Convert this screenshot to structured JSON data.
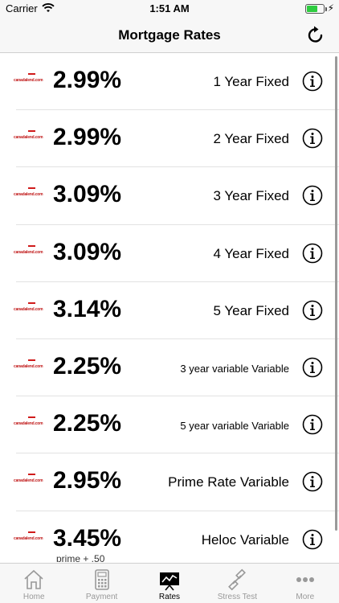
{
  "status_bar": {
    "carrier": "Carrier",
    "time": "1:51 AM"
  },
  "header": {
    "title": "Mortgage Rates"
  },
  "lender_logo_text": "canadalend.com",
  "rates": [
    {
      "rate": "2.99%",
      "term": "1 Year Fixed",
      "note": "",
      "small": false
    },
    {
      "rate": "2.99%",
      "term": "2 Year Fixed",
      "note": "",
      "small": false
    },
    {
      "rate": "3.09%",
      "term": "3 Year Fixed",
      "note": "",
      "small": false
    },
    {
      "rate": "3.09%",
      "term": "4 Year Fixed",
      "note": "",
      "small": false
    },
    {
      "rate": "3.14%",
      "term": "5 Year Fixed",
      "note": "",
      "small": false
    },
    {
      "rate": "2.25%",
      "term": "3 year variable Variable",
      "note": "",
      "small": true
    },
    {
      "rate": "2.25%",
      "term": "5 year variable Variable",
      "note": "",
      "small": true
    },
    {
      "rate": "2.95%",
      "term": "Prime Rate Variable",
      "note": "",
      "small": false
    },
    {
      "rate": "3.45%",
      "term": "Heloc Variable",
      "note": "prime + .50",
      "small": false
    }
  ],
  "tabs": [
    {
      "label": "Home",
      "icon": "home-icon"
    },
    {
      "label": "Payment",
      "icon": "calculator-icon"
    },
    {
      "label": "Rates",
      "icon": "chart-icon"
    },
    {
      "label": "Stress Test",
      "icon": "dumbbell-icon"
    },
    {
      "label": "More",
      "icon": "more-icon"
    }
  ],
  "active_tab": "Rates",
  "colors": {
    "accent": "#000000",
    "inactive": "#999999",
    "logo_red": "#c01818"
  }
}
